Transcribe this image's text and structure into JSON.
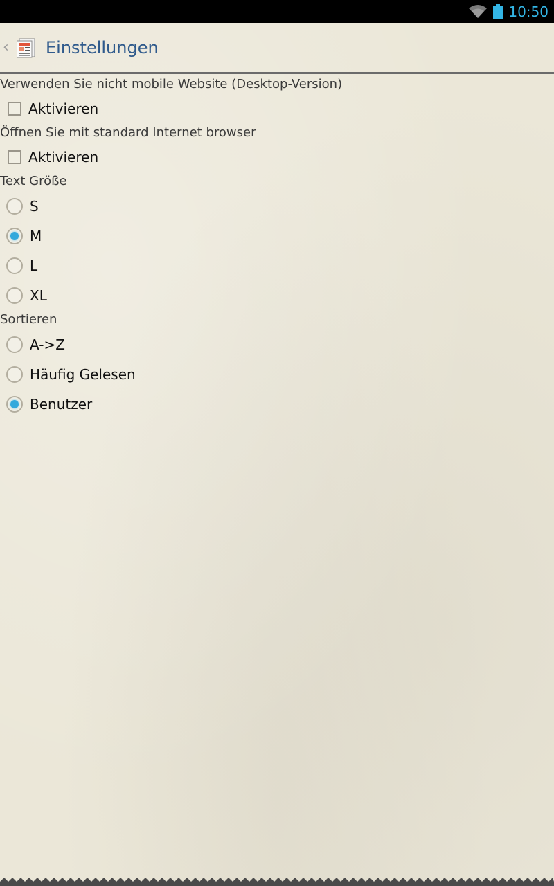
{
  "status_bar": {
    "time": "10:50",
    "icons": [
      "wifi-icon",
      "battery-icon"
    ],
    "accent_color": "#33b5e5"
  },
  "action_bar": {
    "title": "Einstellungen",
    "icons": [
      "back-caret-icon",
      "app-news-icon"
    ],
    "title_color": "#2f5a8c"
  },
  "settings": {
    "desktop_version": {
      "label": "Verwenden Sie nicht mobile Website (Desktop-Version)",
      "option_label": "Aktivieren",
      "checked": false
    },
    "default_browser": {
      "label": "Öffnen Sie mit standard Internet browser",
      "option_label": "Aktivieren",
      "checked": false
    },
    "text_size": {
      "label": "Text Größe",
      "options": [
        "S",
        "M",
        "L",
        "XL"
      ],
      "selected": "M"
    },
    "sort": {
      "label": "Sortieren",
      "options": [
        "A->Z",
        "Häufig Gelesen",
        "Benutzer"
      ],
      "selected": "Benutzer"
    }
  },
  "colors": {
    "background": "#ebe7d8",
    "radio_selected": "#33a9dc",
    "divider": "#6b6b6b"
  }
}
